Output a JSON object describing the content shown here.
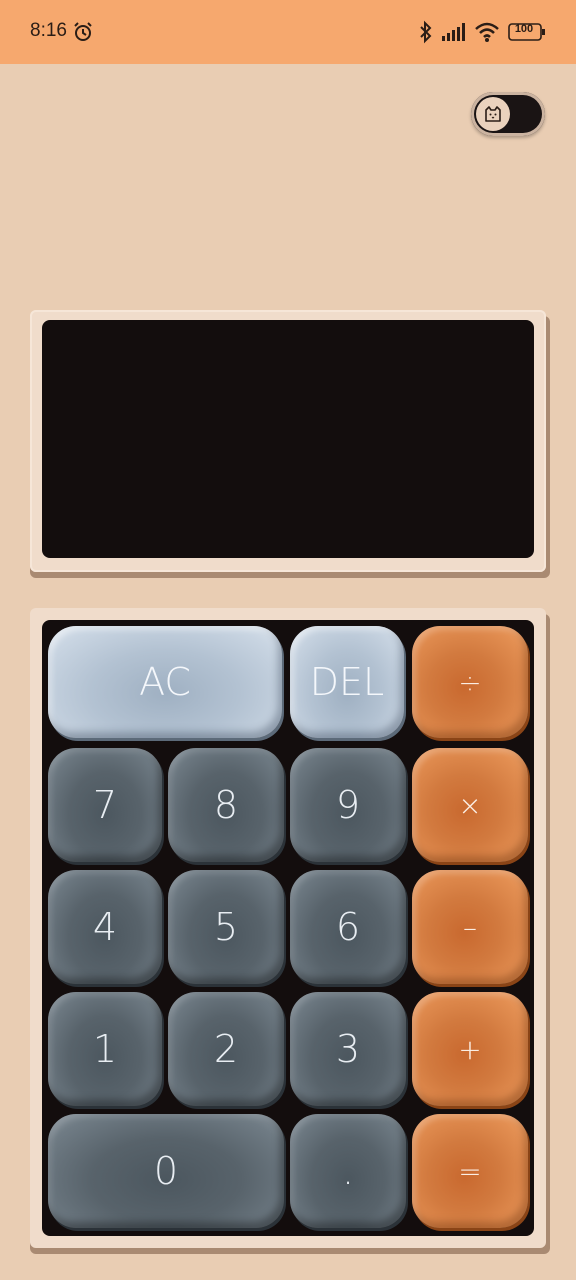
{
  "status_bar": {
    "time": "8:16",
    "battery": "100",
    "icons": [
      "alarm-icon",
      "bluetooth-icon",
      "signal-icon",
      "wifi-icon",
      "battery-icon"
    ]
  },
  "theme_toggle": {
    "icon": "cat-icon",
    "state": "off"
  },
  "display": {
    "value": ""
  },
  "keypad": {
    "ac": "AC",
    "del": "DEL",
    "divide": "÷",
    "multiply": "×",
    "minus": "–",
    "plus": "+",
    "equals": "=",
    "seven": "7",
    "eight": "8",
    "nine": "9",
    "four": "4",
    "five": "5",
    "six": "6",
    "one": "1",
    "two": "2",
    "three": "3",
    "zero": "0",
    "dot": "."
  },
  "colors": {
    "background": "#e9cdb3",
    "status_bar": "#f6a86e",
    "screen": "#130d0d",
    "key_dark": "#5b666e",
    "key_light": "#b7c5d4",
    "key_orange": "#d97f42"
  }
}
